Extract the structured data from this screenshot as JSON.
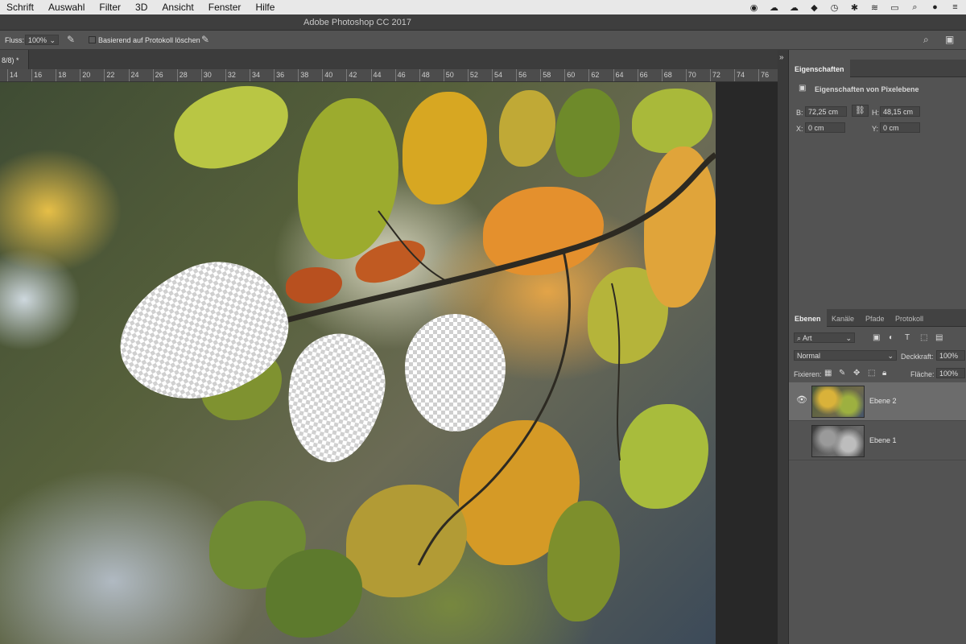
{
  "menubar": {
    "items": [
      "Schrift",
      "Auswahl",
      "Filter",
      "3D",
      "Ansicht",
      "Fenster",
      "Hilfe"
    ],
    "status_icons": [
      "record-icon",
      "cloud-sync-icon",
      "cloud-icon",
      "clip-icon",
      "time-machine-icon",
      "bluetooth-icon",
      "wifi-icon",
      "airplay-icon",
      "search-icon",
      "siri-icon",
      "list-icon"
    ]
  },
  "title": "Adobe Photoshop CC 2017",
  "options": {
    "flow_label": "Fluss:",
    "flow_value": "100%",
    "protocol_label": "Basierend auf Protokoll löschen"
  },
  "document": {
    "tab_label": "8/8) *"
  },
  "ruler": {
    "ticks": [
      "14",
      "16",
      "18",
      "20",
      "22",
      "24",
      "26",
      "28",
      "30",
      "32",
      "34",
      "36",
      "38",
      "40",
      "42",
      "44",
      "46",
      "48",
      "50",
      "52",
      "54",
      "56",
      "58",
      "60",
      "62",
      "64",
      "66",
      "68",
      "70",
      "72",
      "74",
      "76"
    ]
  },
  "properties": {
    "tab": "Eigenschaften",
    "section": "Eigenschaften von Pixelebene",
    "b_label": "B:",
    "b_value": "72,25 cm",
    "h_label": "H:",
    "h_value": "48,15 cm",
    "x_label": "X:",
    "x_value": "0 cm",
    "y_label": "Y:",
    "y_value": "0 cm"
  },
  "layers": {
    "tabs": [
      "Ebenen",
      "Kanäle",
      "Pfade",
      "Protokoll"
    ],
    "filter_value": "Art",
    "blend_mode": "Normal",
    "opacity_label": "Deckkraft:",
    "opacity_value": "100%",
    "lock_label": "Fixieren:",
    "fill_label": "Fläche:",
    "fill_value": "100%",
    "items": [
      {
        "name": "Ebene 2",
        "visible": true,
        "selected": true
      },
      {
        "name": "Ebene 1",
        "visible": false,
        "selected": false
      }
    ]
  }
}
